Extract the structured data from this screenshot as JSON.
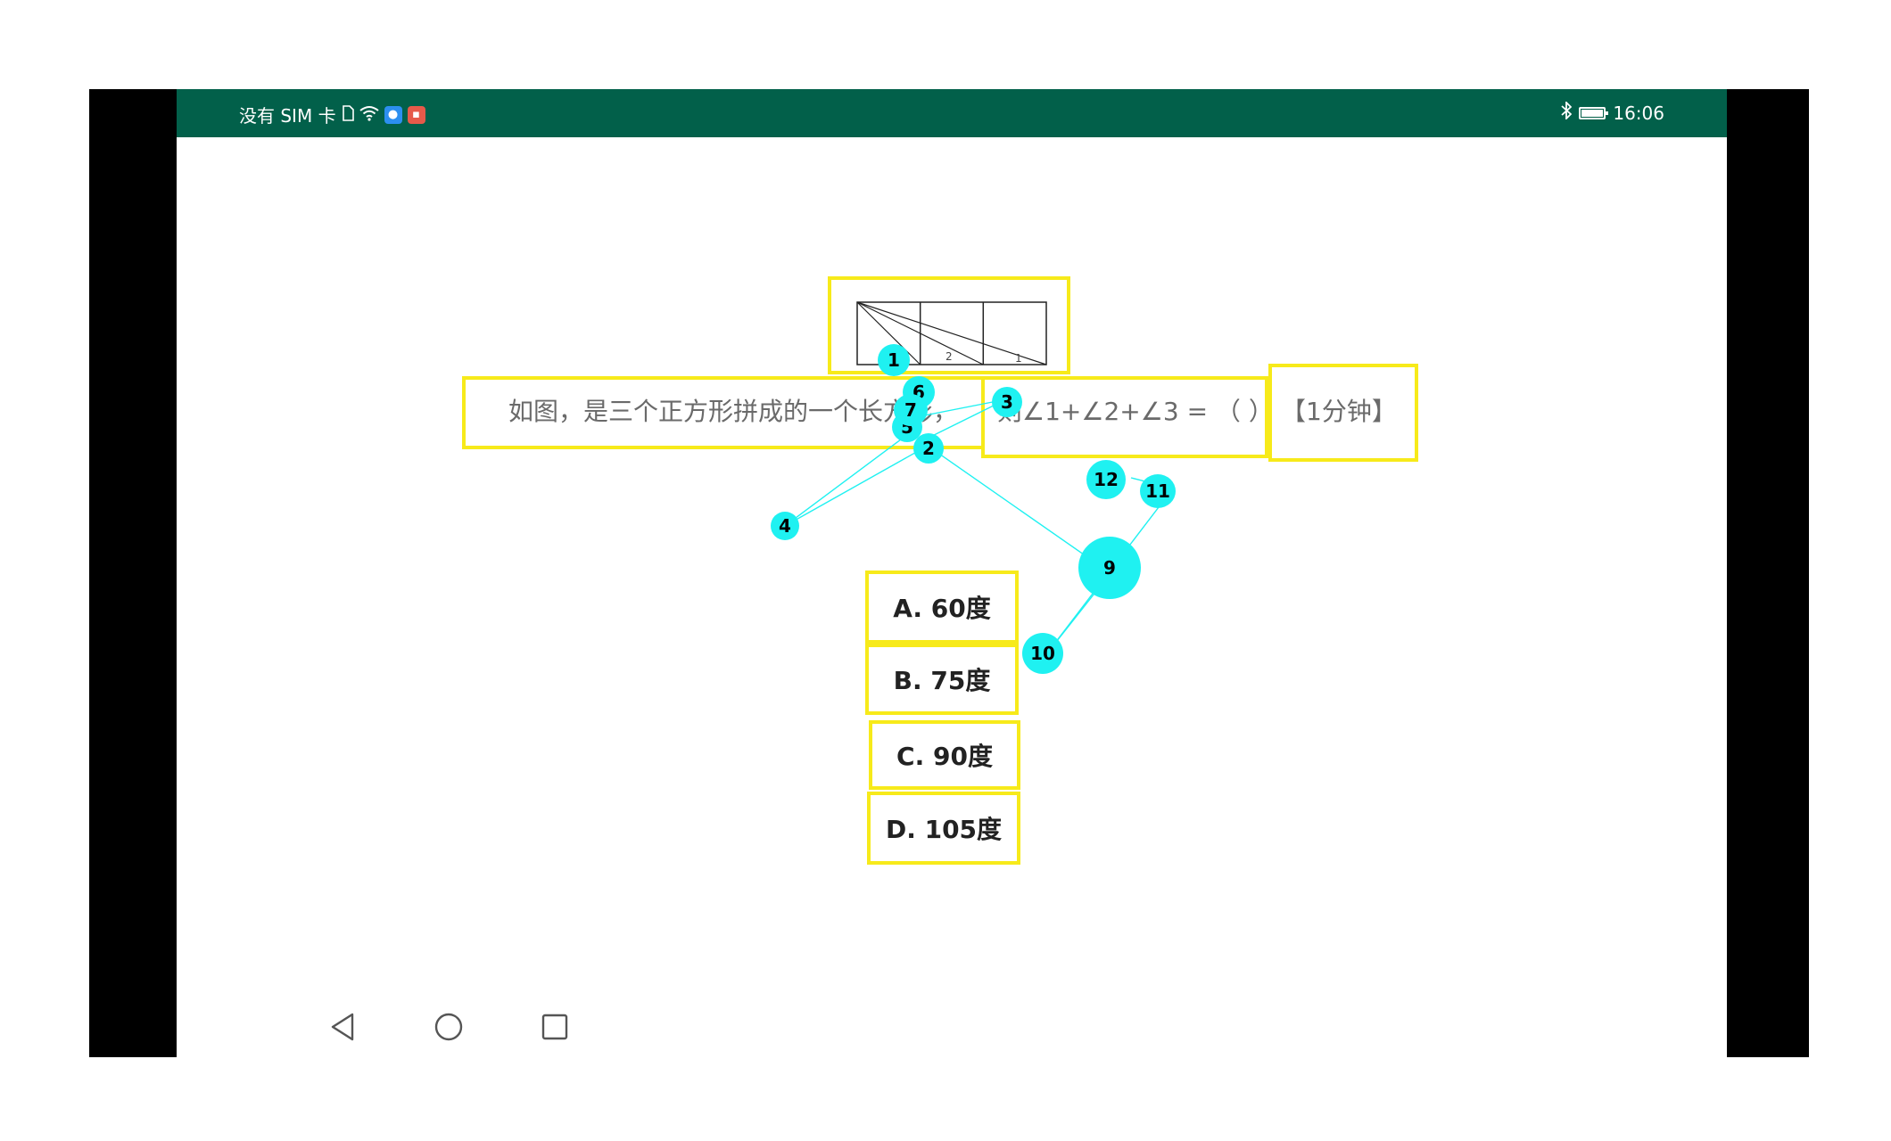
{
  "status_bar": {
    "carrier": "没有 SIM 卡",
    "time": "16:06",
    "colors": {
      "background": "#02604a",
      "text": "#ffffff"
    },
    "icons": [
      "sim-card-icon",
      "wifi-icon",
      "app-notification-icon",
      "image-notification-icon",
      "bluetooth-icon",
      "battery-icon"
    ]
  },
  "question": {
    "text_part1": "如图，是三个正方形拼成的一个长方形，",
    "text_part2": "则∠1+∠2+∠3 = （ ）",
    "time_hint": "【1分钟】",
    "figure_labels": [
      "3",
      "2",
      "1"
    ]
  },
  "options": [
    {
      "label": "A. 60度"
    },
    {
      "label": "B. 75度"
    },
    {
      "label": "C. 90度"
    },
    {
      "label": "D. 105度"
    }
  ],
  "markers": [
    "1",
    "2",
    "3",
    "4",
    "5",
    "6",
    "7",
    "9",
    "10",
    "11",
    "12"
  ],
  "nav_bar": {
    "icons": [
      "back-icon",
      "home-icon",
      "recents-icon"
    ]
  },
  "colors": {
    "highlight_box": "#f7ea1a",
    "marker": "#1ff1f1"
  }
}
